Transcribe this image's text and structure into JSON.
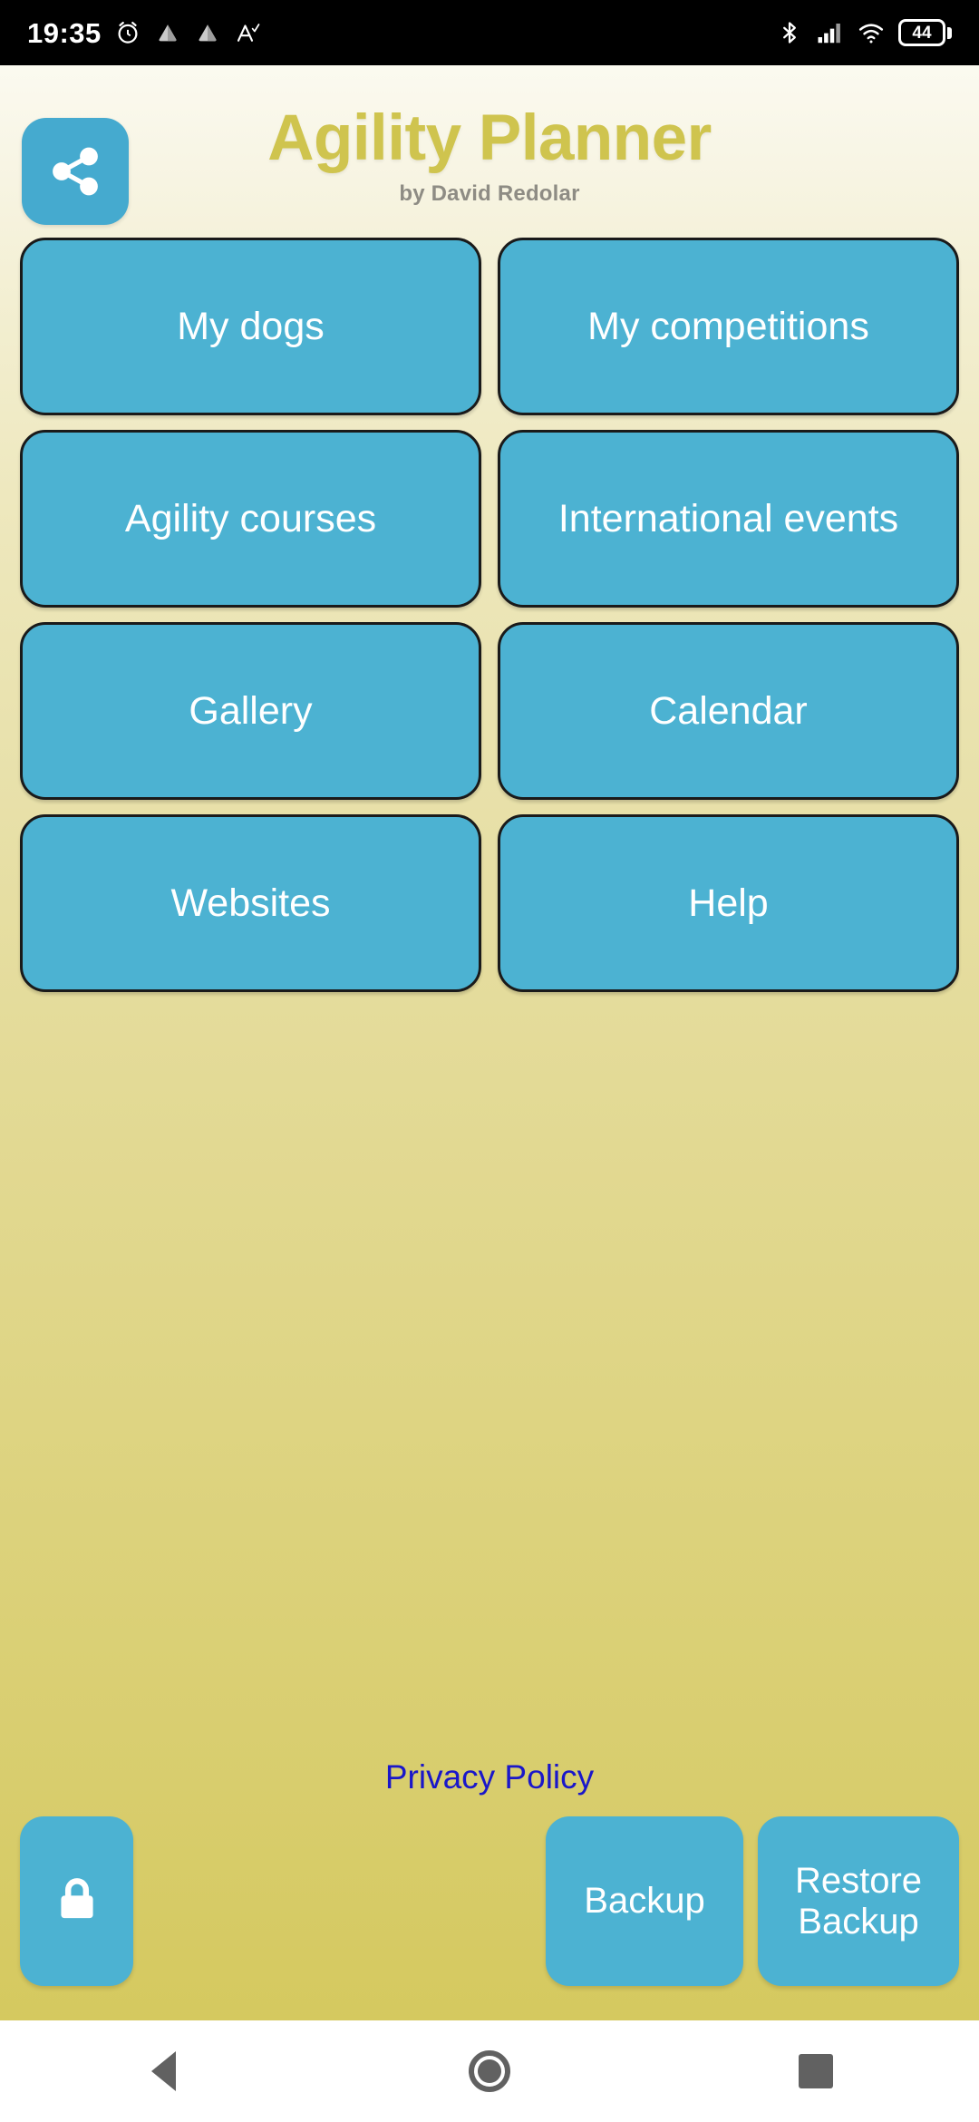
{
  "status_bar": {
    "time": "19:35",
    "battery_level": "44",
    "left_icons": [
      "alarm-icon",
      "cloud-icon",
      "cloud-icon",
      "a-check-icon"
    ],
    "right_icons": [
      "bluetooth-icon",
      "signal-icon",
      "wifi-icon",
      "battery-icon"
    ]
  },
  "header": {
    "share_icon": "share-icon",
    "title": "Agility Planner",
    "subtitle": "by David Redolar",
    "title_color": "#cfc44e",
    "accent_color": "#4cb2d2"
  },
  "menu": {
    "rows": [
      [
        {
          "label": "My dogs",
          "name": "my-dogs"
        },
        {
          "label": "My competitions",
          "name": "my-competitions"
        }
      ],
      [
        {
          "label": "Agility courses",
          "name": "agility-courses"
        },
        {
          "label": "International events",
          "name": "international-events"
        }
      ],
      [
        {
          "label": "Gallery",
          "name": "gallery"
        },
        {
          "label": "Calendar",
          "name": "calendar"
        }
      ],
      [
        {
          "label": "Websites",
          "name": "websites"
        },
        {
          "label": "Help",
          "name": "help"
        }
      ]
    ]
  },
  "footer": {
    "privacy_label": "Privacy Policy",
    "privacy_color": "#1a17c9",
    "lock_icon": "lock-icon",
    "backup_label": "Backup",
    "restore_label": "Restore Backup"
  },
  "nav_bar": {
    "back": "back-triangle-icon",
    "home": "home-circle-icon",
    "recents": "recents-square-icon"
  }
}
